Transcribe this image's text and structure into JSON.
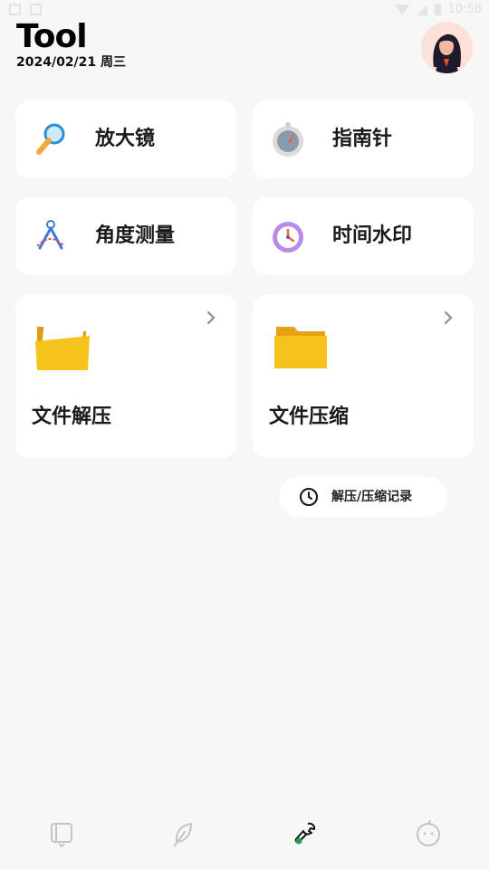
{
  "status_bar": {
    "time": "10:58"
  },
  "header": {
    "title": "Tool",
    "date": "2024/02/21 周三"
  },
  "tools": {
    "magnifier": {
      "label": "放大镜",
      "icon": "magnifier-icon"
    },
    "compass": {
      "label": "指南针",
      "icon": "compass-icon"
    },
    "protractor": {
      "label": "角度测量",
      "icon": "protractor-icon"
    },
    "time_watermark": {
      "label": "时间水印",
      "icon": "clock-icon"
    },
    "unzip": {
      "label": "文件解压",
      "icon": "open-folder-icon"
    },
    "zip": {
      "label": "文件压缩",
      "icon": "folder-icon"
    }
  },
  "history_button": {
    "label": "解压/压缩记录",
    "icon": "clock-icon"
  },
  "tab_bar": {
    "items": [
      {
        "name": "notes-tab",
        "icon": "tablet-icon",
        "active": false
      },
      {
        "name": "feather-tab",
        "icon": "feather-icon",
        "active": false
      },
      {
        "name": "tools-tab",
        "icon": "wrench-icon",
        "active": true
      },
      {
        "name": "profile-tab",
        "icon": "face-icon",
        "active": false
      }
    ]
  },
  "colors": {
    "background": "#f7f7f7",
    "card": "#ffffff",
    "accent_active": "#1f9d55",
    "folder_yellow": "#f6c31d"
  }
}
